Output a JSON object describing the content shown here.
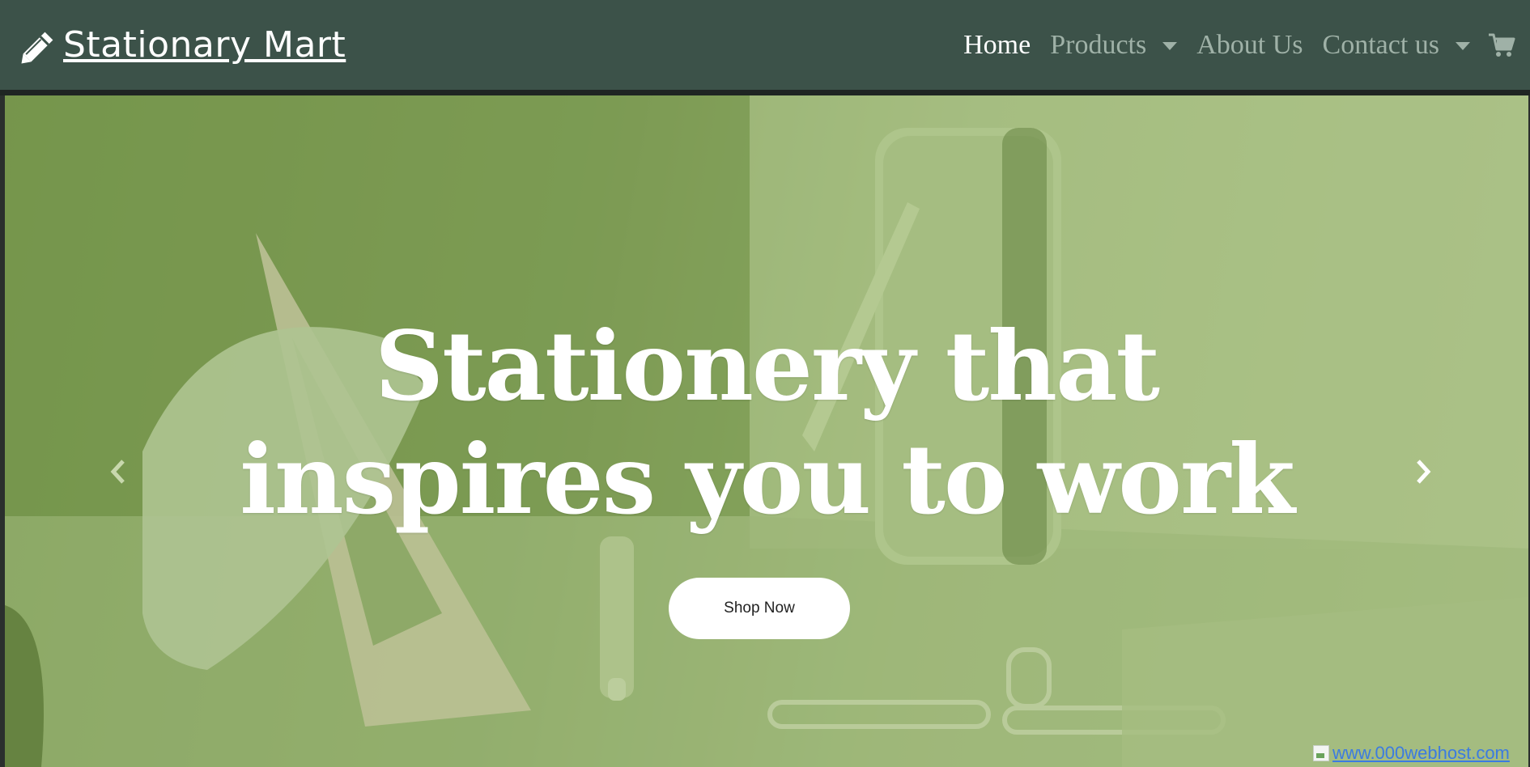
{
  "navbar": {
    "brand": "Stationary Mart",
    "brand_icon": "pencil-icon",
    "links": [
      {
        "label": "Home",
        "active": true,
        "dropdown": false
      },
      {
        "label": "Products",
        "active": false,
        "dropdown": true
      },
      {
        "label": "About Us",
        "active": false,
        "dropdown": false
      },
      {
        "label": "Contact us",
        "active": false,
        "dropdown": true
      }
    ],
    "cart_icon": "cart-icon",
    "colors": {
      "background": "#3c5249",
      "active_link": "#ffffff",
      "inactive_link": "#9fb1a7"
    }
  },
  "hero": {
    "headline_line1": "Stationery that",
    "headline_line2": "inspires you to work",
    "cta_label": "Shop Now",
    "prev_icon": "chevron-left-icon",
    "next_icon": "chevron-right-icon",
    "colors": {
      "tint": "#8aa864"
    }
  },
  "footer_badge": {
    "text": "www.000webhost.com"
  }
}
